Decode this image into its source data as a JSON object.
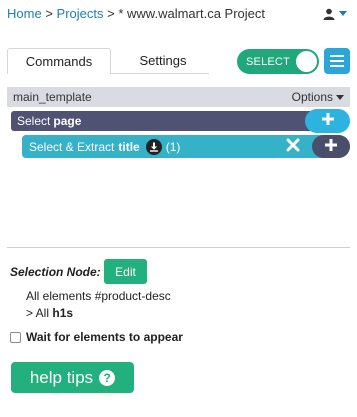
{
  "breadcrumb": {
    "home": "Home",
    "sep1": ">",
    "projects": "Projects",
    "sep2": ">",
    "current": "* www.walmart.ca Project"
  },
  "user_menu": {
    "icon": "user-icon",
    "caret": "caret-down-icon"
  },
  "tabs": [
    {
      "label": "Commands",
      "active": true
    },
    {
      "label": "Settings",
      "active": false
    }
  ],
  "select_toggle": {
    "label": "SELECT",
    "on": true,
    "color": "#21a87a"
  },
  "template": {
    "name": "main_template",
    "options_label": "Options"
  },
  "commands": {
    "select": {
      "prefix": "Select",
      "target": "page"
    },
    "extract": {
      "prefix": "Select & Extract",
      "target": "title",
      "count": "(1)"
    }
  },
  "selection_node": {
    "label": "Selection Node:",
    "edit_label": "Edit",
    "line1": "All elements #product-desc",
    "line2_prefix": "> All",
    "line2_tag": "h1s"
  },
  "wait_checkbox": {
    "label": "Wait for elements to appear",
    "checked": false
  },
  "help_button": {
    "label": "help tips"
  },
  "colors": {
    "link": "#1a7fb8",
    "green": "#22b07e",
    "blue": "#2db3e0",
    "dark_slate": "#4f5273",
    "teal": "#35b1c8"
  }
}
